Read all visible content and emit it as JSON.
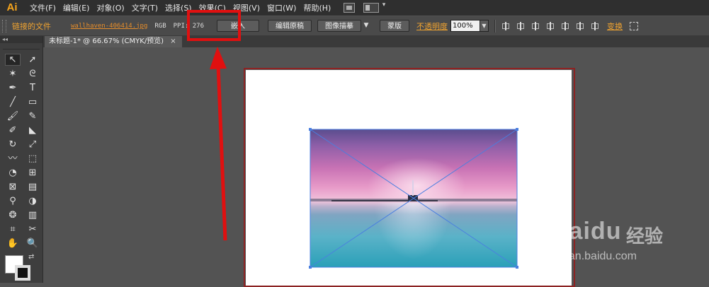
{
  "app": {
    "logo": "Ai"
  },
  "menu": [
    "文件(F)",
    "编辑(E)",
    "对象(O)",
    "文字(T)",
    "选择(S)",
    "效果(C)",
    "视图(V)",
    "窗口(W)",
    "帮助(H)"
  ],
  "controlbar": {
    "linked_label": "链接的文件",
    "filename": "wallhaven-406414.jpg",
    "colormode": "RGB",
    "ppi": "PPI: 276",
    "embed": "嵌入",
    "edit_original": "编辑原稿",
    "image_trace": "图像描摹",
    "mask": "蒙版",
    "opacity_label": "不透明度",
    "opacity_value": "100%",
    "transform": "变换"
  },
  "document": {
    "tab_title": "未标题-1* @ 66.67% (CMYK/预览)",
    "close": "×"
  },
  "tools": [
    "selection-icon",
    "direct-selection-icon",
    "magic-wand-icon",
    "lasso-icon",
    "pen-icon",
    "type-icon",
    "line-icon",
    "rectangle-icon",
    "paintbrush-icon",
    "pencil-icon",
    "blob-brush-icon",
    "eraser-icon",
    "rotate-icon",
    "scale-icon",
    "warp-icon",
    "free-transform-icon",
    "shape-builder-icon",
    "perspective-icon",
    "mesh-icon",
    "gradient-icon",
    "eyedropper-icon",
    "blend-icon",
    "symbol-sprayer-icon",
    "column-graph-icon",
    "artboard-icon",
    "slice-icon",
    "hand-icon",
    "zoom-icon"
  ],
  "tool_glyphs": [
    "↖",
    "➚",
    "✶",
    "ᘓ",
    "✒",
    "T",
    "╱",
    "▭",
    "🖌",
    "✎",
    "✐",
    "◣",
    "↻",
    "⤢",
    "〰",
    "⬚",
    "◔",
    "⊞",
    "⊠",
    "▤",
    "⚲",
    "◑",
    "❂",
    "▥",
    "⌗",
    "✂",
    "✋",
    "🔍"
  ],
  "colors": {
    "accent_orange": "#f0a330",
    "highlight_red": "#e01010",
    "selection_blue": "#4a7fe0",
    "artboard_border": "#8c2323"
  },
  "watermark": {
    "brand": "Bai",
    "paw": "du",
    "cn": "经验",
    "url": "jingyan.baidu.com"
  }
}
